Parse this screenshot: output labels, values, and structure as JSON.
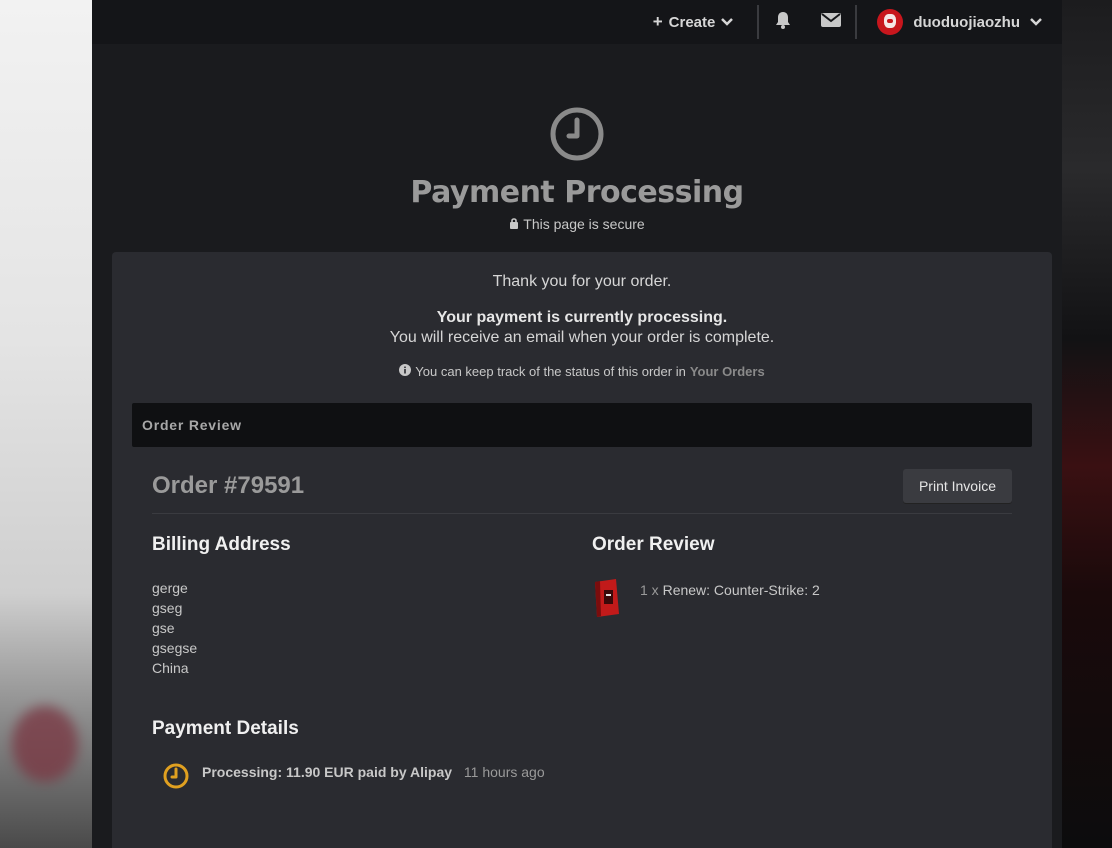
{
  "nav": {
    "create_label": "Create",
    "username": "duoduojiaozhu"
  },
  "hero": {
    "title": "Payment Processing",
    "secure_text": "This page is secure"
  },
  "message": {
    "thanks": "Thank you for your order.",
    "processing_bold": "Your payment is currently processing.",
    "processing_sub": "You will receive an email when your order is complete.",
    "track_prefix": "You can keep track of the status of this order in",
    "track_link": "Your Orders"
  },
  "order": {
    "review_bar_label": "Order Review",
    "title": "Order #79591",
    "print_label": "Print Invoice",
    "billing": {
      "heading": "Billing Address",
      "lines": [
        "gerge",
        "gseg",
        "gse",
        "gsegse",
        "China"
      ]
    },
    "review": {
      "heading": "Order Review",
      "item_qty": "1 x",
      "item_name": "Renew: Counter-Strike: 2"
    },
    "payment": {
      "heading": "Payment Details",
      "status": "Processing: 11.90 EUR paid by Alipay",
      "time": "11 hours ago"
    }
  },
  "colors": {
    "accent_clock": "#e0a020",
    "panel": "#2a2b30",
    "topbar": "#141518"
  }
}
